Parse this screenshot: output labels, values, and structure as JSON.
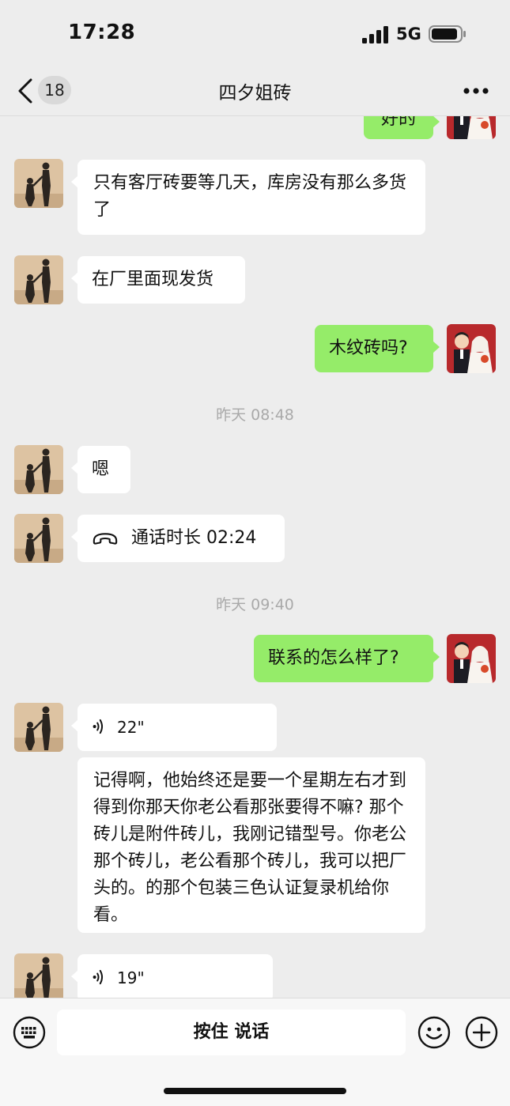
{
  "status": {
    "time": "17:28",
    "network": "5G"
  },
  "nav": {
    "title": "四夕姐砖",
    "unread": "18"
  },
  "messages": {
    "m0": "好的",
    "m1": "只有客厅砖要等几天，库房没有那么多货了",
    "m2": "在厂里面现发货",
    "m3": "木纹砖吗?",
    "t1": "昨天 08:48",
    "m4": "嗯",
    "call": "通话时长 02:24",
    "t2": "昨天 09:40",
    "m5": "联系的怎么样了?",
    "v1": "22\"",
    "transcript": "记得啊，他始终还是要一个星期左右才到得到你那天你老公看那张要得不嘛? 那个砖儿是附件砖儿，我刚记错型号。你老公那个砖儿，老公看那个砖儿，我可以把厂头的。的那个包装三色认证复录机给你看。",
    "v2": "19\""
  },
  "input": {
    "hold_to_talk": "按住 说话"
  },
  "colors": {
    "bg": "#ededed",
    "outgoing": "#95ec69",
    "incoming": "#ffffff",
    "stamp": "#a9a9a9"
  },
  "icons": [
    "back-chevron-icon",
    "more-icon",
    "phone-icon",
    "voice-wave-icon",
    "keyboard-icon",
    "emoji-icon",
    "plus-icon"
  ]
}
